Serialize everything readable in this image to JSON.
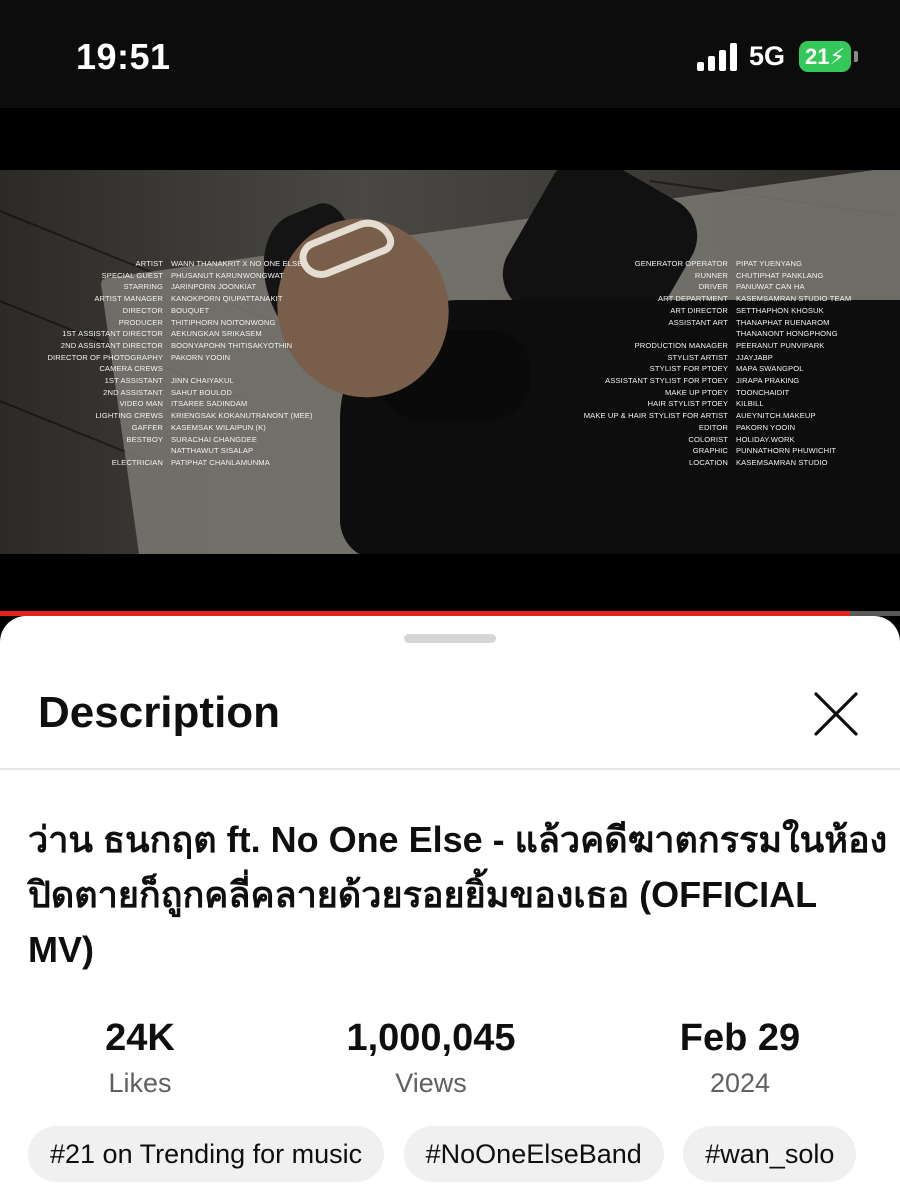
{
  "status_bar": {
    "time": "19:51",
    "network": "5G",
    "battery": "21",
    "battery_color": "#34c759"
  },
  "video": {
    "progress": 0.944,
    "progress_color": "#e62117",
    "credits_left": [
      {
        "role": "Artist",
        "name": "Wann Thanakrit x No One Else"
      },
      {
        "role": "Special Guest",
        "name": "Phusanut Karunwongwat"
      },
      {
        "role": "Starring",
        "name": "Jarinporn Joonkiat"
      },
      {
        "role": "Artist Manager",
        "name": "Kanokporn Qiupattanakit"
      },
      {
        "role": "Director",
        "name": "Bouquet"
      },
      {
        "role": "Producer",
        "name": "Thitiphorn Noitonwong"
      },
      {
        "role": "1st Assistant Director",
        "name": "Aekungkan Srikasem"
      },
      {
        "role": "2nd Assistant Director",
        "name": "Boonyapohn Thitisakyothin"
      },
      {
        "role": "Director of Photography",
        "name": "Pakorn Yooin"
      },
      {
        "role": "Camera Crews",
        "name": ""
      },
      {
        "role": "1st Assistant",
        "name": "Jinn Chaiyakul"
      },
      {
        "role": "2nd Assistant",
        "name": "Sahut Boulod"
      },
      {
        "role": "Video Man",
        "name": "Itsaree Sadindam"
      },
      {
        "role": "Lighting Crews",
        "name": "Kriengsak Kokanutranont (Mee)"
      },
      {
        "role": "Gaffer",
        "name": "Kasemsak Wilaipun (K)"
      },
      {
        "role": "Bestboy",
        "name": "Surachai Changdee"
      },
      {
        "role": "",
        "name": "Natthawut Sisalap"
      },
      {
        "role": "Electrician",
        "name": "Patiphat Chanlamunma"
      }
    ],
    "credits_right": [
      {
        "role": "Generator Operator",
        "name": "Pipat Yuenyang"
      },
      {
        "role": "Runner",
        "name": "Chutiphat Panklang"
      },
      {
        "role": "Driver",
        "name": "Panuwat Can Ha"
      },
      {
        "role": "Art Department",
        "name": "Kasemsamran Studio Team"
      },
      {
        "role": "Art Director",
        "name": "Setthaphon Khosuk"
      },
      {
        "role": "Assistant Art",
        "name": "Thanaphat Ruenarom"
      },
      {
        "role": "",
        "name": "Thananont Hongphong"
      },
      {
        "role": "Production Manager",
        "name": "Peeranut Punvipark"
      },
      {
        "role": "Stylist Artist",
        "name": "Jjayjabp"
      },
      {
        "role": "Stylist for Ptoey",
        "name": "Mapa Swangpol"
      },
      {
        "role": "Assistant Stylist for Ptoey",
        "name": "Jirapa Praking"
      },
      {
        "role": "Make up Ptoey",
        "name": "Toonchaidit"
      },
      {
        "role": "Hair Stylist Ptoey",
        "name": "Kilbill"
      },
      {
        "role": "Make up & Hair Stylist for Artist",
        "name": "Aueynitch.makeup"
      },
      {
        "role": "Editor",
        "name": "Pakorn Yooin"
      },
      {
        "role": "Colorist",
        "name": "Holiday.work"
      },
      {
        "role": "Graphic",
        "name": "Punnathorn Phuwichit"
      },
      {
        "role": "Location",
        "name": "Kasemsamran Studio"
      }
    ]
  },
  "description": {
    "heading": "Description",
    "title": "ว่าน ธนกฤต ft. No One Else - แล้วคดีฆาตกรรมในห้องปิดตายก็ถูกคลี่คลายด้วยรอยยิ้มของเธอ (OFFICIAL MV)",
    "stats": {
      "likes_value": "24K",
      "likes_label": "Likes",
      "views_value": "1,000,045",
      "views_label": "Views",
      "date_value": "Feb 29",
      "date_year": "2024"
    },
    "chips": [
      "#21 on Trending for music",
      "#NoOneElseBand",
      "#wan_solo"
    ]
  }
}
